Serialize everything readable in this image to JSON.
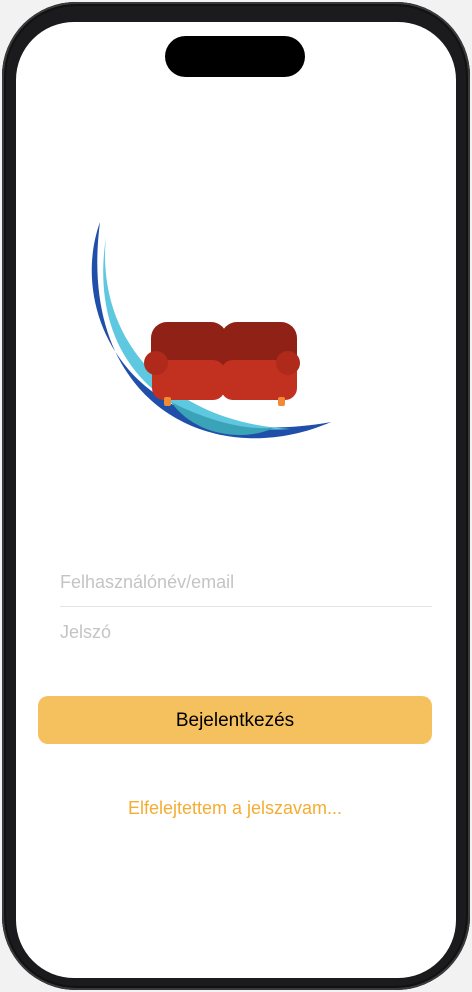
{
  "login": {
    "username_placeholder": "Felhasználónév/email",
    "password_placeholder": "Jelszó",
    "login_button_label": "Bejelentkezés",
    "forgot_password_link": "Elfelejtettem a jelszavam..."
  },
  "logo": {
    "icon": "sofa-icon",
    "colors": {
      "wave_dark": "#1f4fa8",
      "wave_light": "#5ec8e0",
      "wave_teal": "#3aa3b8",
      "sofa_red": "#c2301f",
      "sofa_dark": "#8f2117",
      "sofa_legs": "#f08a35"
    }
  },
  "theme": {
    "button_color": "#f5c15e",
    "link_color": "#f4ad32",
    "placeholder_color": "#c4c4c6"
  }
}
